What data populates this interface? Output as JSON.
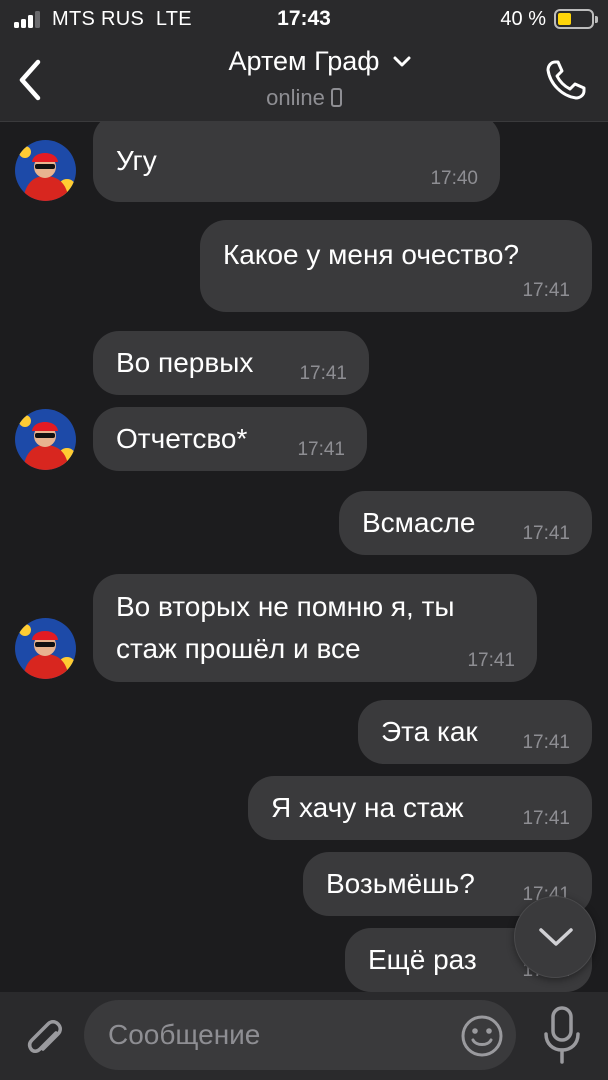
{
  "status_bar": {
    "carrier": "MTS RUS",
    "network": "LTE",
    "time": "17:43",
    "battery_percent": "40 %",
    "battery_level": 0.4,
    "battery_color": "#ffd60a"
  },
  "header": {
    "back_icon": "chevron-left-icon",
    "contact_name": "Артем Граф",
    "presence": "online",
    "presence_icon": "mobile-device-icon",
    "call_icon": "phone-icon"
  },
  "messages": [
    {
      "side": "in",
      "text": "Угу",
      "time": "17:40",
      "avatar": true
    },
    {
      "side": "out",
      "text": "Какое у меня очество?",
      "time": "17:41"
    },
    {
      "side": "in",
      "text": "Во первых",
      "time": "17:41"
    },
    {
      "side": "in",
      "text": "Отчетсво*",
      "time": "17:41",
      "avatar": true
    },
    {
      "side": "out",
      "text": "Всмасле",
      "time": "17:41"
    },
    {
      "side": "in",
      "lines": [
        "Во вторых не помню я, ты",
        "стаж прошёл и все"
      ],
      "time": "17:41",
      "avatar": true
    },
    {
      "side": "out",
      "text": "Эта как",
      "time": "17:41"
    },
    {
      "side": "out",
      "text": "Я хачу на стаж",
      "time": "17:41"
    },
    {
      "side": "out",
      "text": "Возьмёшь?",
      "time": "17:41"
    },
    {
      "side": "out",
      "text": "Ещё раз",
      "time": "17:41"
    }
  ],
  "composer": {
    "placeholder": "Сообщение",
    "attach_icon": "paperclip-icon",
    "emoji_icon": "smiley-icon",
    "mic_icon": "microphone-icon",
    "scroll_icon": "chevron-down-icon"
  },
  "colors": {
    "background": "#1c1c1e",
    "bar": "#2a2a2c",
    "bubble": "#3a3a3c",
    "secondary_text": "#8e8e93"
  }
}
